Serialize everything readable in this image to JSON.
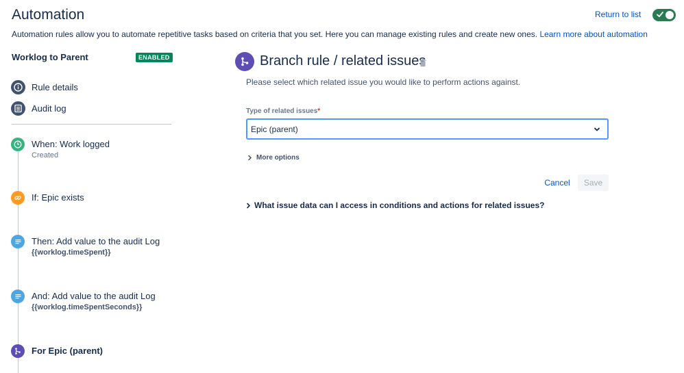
{
  "header": {
    "title": "Automation",
    "return_link": "Return to list",
    "toggle_on": true,
    "intro_text": "Automation rules allow you to automate repetitive tasks based on criteria that you set. Here you can manage existing rules and create new ones.",
    "intro_link": "Learn more about automation"
  },
  "sidebar": {
    "rule_name": "Worklog to Parent",
    "status_badge": "ENABLED",
    "nav": [
      {
        "label": "Rule details",
        "icon": "info-icon"
      },
      {
        "label": "Audit log",
        "icon": "list-icon"
      }
    ],
    "steps": [
      {
        "title": "When: Work logged",
        "sub": "Created",
        "icon": "clock-icon",
        "color": "#36b37e"
      },
      {
        "title": "If: Epic exists",
        "sub": "",
        "icon": "link-icon",
        "color": "#ff991f"
      },
      {
        "title": "Then: Add value to the audit Log",
        "sub": "{{worklog.timeSpent}}",
        "icon": "document-icon",
        "color": "#4da6e0"
      },
      {
        "title": "And: Add value to the audit Log",
        "sub": "{{worklog.timeSpentSeconds}}",
        "icon": "document-icon",
        "color": "#4da6e0"
      },
      {
        "title": "For Epic (parent)",
        "sub": "",
        "icon": "branch-icon",
        "color": "#5e4db2"
      }
    ]
  },
  "main": {
    "title": "Branch rule / related issues",
    "subtitle": "Please select which related issue you would like to perform actions against.",
    "field_label": "Type of related issues",
    "required_mark": "*",
    "select_value": "Epic (parent)",
    "more_options": "More options",
    "cancel_label": "Cancel",
    "save_label": "Save",
    "faq_label": "What issue data can I access in conditions and actions for related issues?"
  },
  "colors": {
    "accent": "#0052cc",
    "enabled_badge": "#00875a",
    "branch_purple": "#5e4db2"
  }
}
